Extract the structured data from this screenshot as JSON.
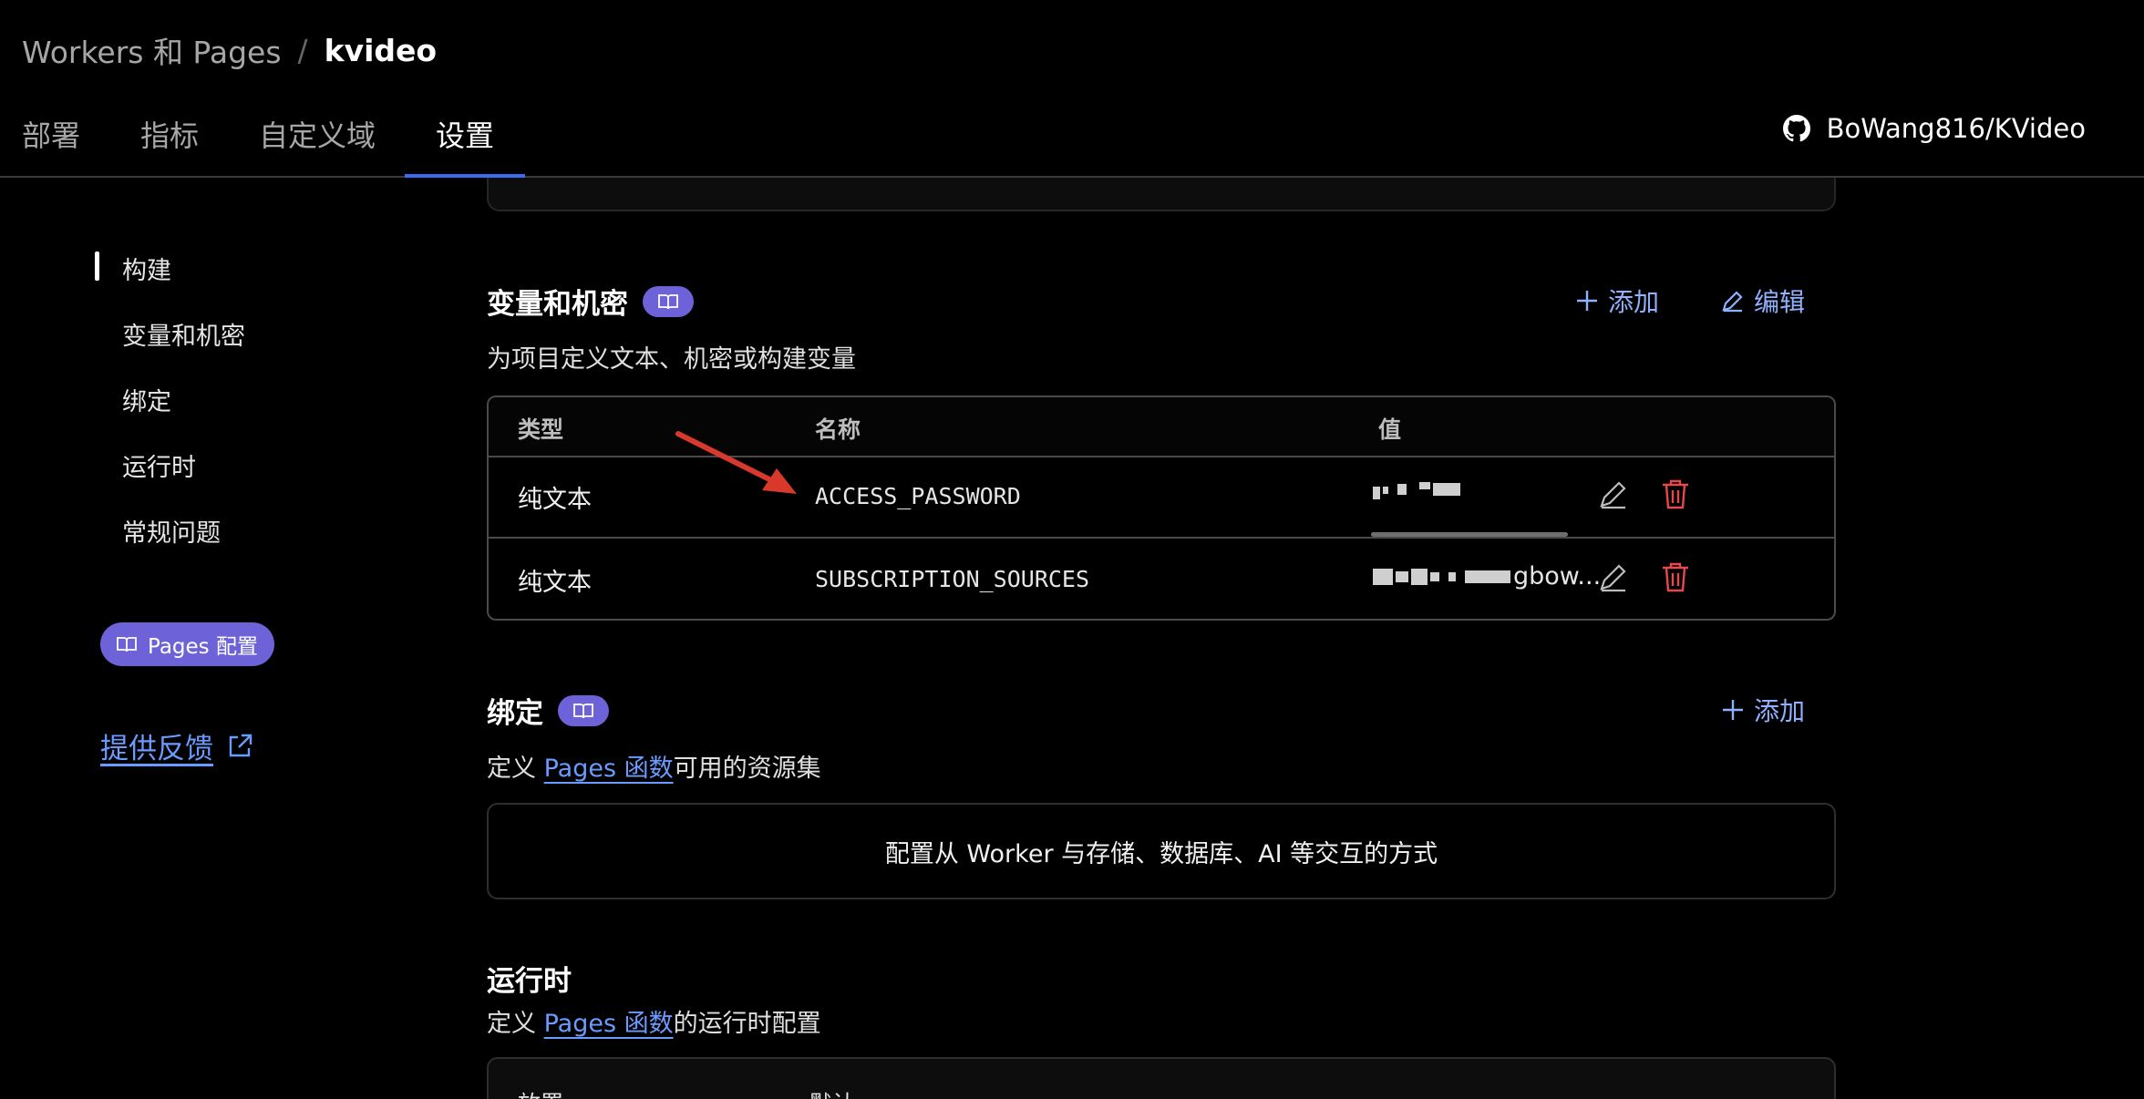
{
  "breadcrumb": {
    "parent": "Workers 和 Pages",
    "separator": "/",
    "current": "kvideo"
  },
  "tabs": [
    {
      "label": "部署"
    },
    {
      "label": "指标"
    },
    {
      "label": "自定义域"
    },
    {
      "label": "设置",
      "active": true
    }
  ],
  "repo": {
    "icon": "github-icon",
    "label": "BoWang816/KVideo"
  },
  "sidebar": {
    "items": [
      {
        "label": "构建",
        "active": true
      },
      {
        "label": "变量和机密"
      },
      {
        "label": "绑定"
      },
      {
        "label": "运行时"
      },
      {
        "label": "常规问题"
      }
    ],
    "pages_config": "Pages 配置",
    "feedback": "提供反馈"
  },
  "variables": {
    "title": "变量和机密",
    "description": "为项目定义文本、机密或构建变量",
    "add_label": "添加",
    "edit_label": "编辑",
    "columns": [
      "类型",
      "名称",
      "值"
    ],
    "rows": [
      {
        "type": "纯文本",
        "name": "ACCESS_PASSWORD",
        "value_suffix": ""
      },
      {
        "type": "纯文本",
        "name": "SUBSCRIPTION_SOURCES",
        "value_suffix": "gbow..."
      }
    ]
  },
  "bindings": {
    "title": "绑定",
    "add_label": "添加",
    "desc_prefix": "定义 ",
    "desc_link": "Pages 函数",
    "desc_suffix": "可用的资源集",
    "empty_text": "配置从 Worker 与存储、数据库、AI 等交互的方式"
  },
  "runtime": {
    "title": "运行时",
    "desc_prefix": "定义 ",
    "desc_link": "Pages 函数",
    "desc_suffix": "的运行时配置",
    "row_label": "放置",
    "row_value": "默认"
  },
  "colors": {
    "accent": "#3b6cf0",
    "badge": "#6d62d8",
    "link": "#6a9bff",
    "danger": "#e5484d",
    "annotation_arrow": "#d8392b"
  }
}
